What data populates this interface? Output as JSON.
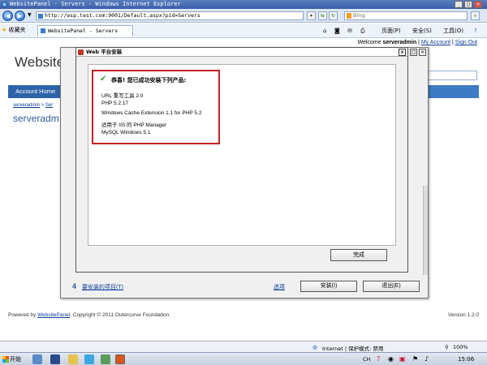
{
  "browser": {
    "window_title": "WebsitePanel - Servers - Windows Internet Explorer",
    "address": "http://wsp.test.com:9001/Default.aspx?pid=Servers",
    "search_placeholder": "Bing",
    "favorites_label": "收藏夹",
    "tab_title": "WebsitePanel - Servers",
    "commands": [
      "页面(P)",
      "安全(S)",
      "工具(O)"
    ],
    "status_zone": "Internet | 保护模式: 禁用",
    "zoom": "100%"
  },
  "page": {
    "welcome_prefix": "Welcome",
    "username": "serveradmin",
    "my_account": "My Account",
    "sign_out": "Sign Out",
    "logo": "Website",
    "menu_item": "Account Home",
    "breadcrumb": "serveradmin",
    "breadcrumb_tail": "Ser",
    "heading": "serveradm",
    "footer_prefix": "Powered by",
    "footer_link": "WebsitePanel",
    "footer_suffix": ". Copyright © 2011 Outercurve Foundation.",
    "version": "Version 1.2.0"
  },
  "outer_dialog": {
    "step_number": "4",
    "to_install_link": "要安装的项目(T)",
    "options_link": "选项",
    "install_button": "安装(I)",
    "exit_button": "退出(E)"
  },
  "inner_dialog": {
    "title": "Web 平台安装",
    "success_heading": "恭喜! 您已成功安装下列产品:",
    "products": [
      "URL 重写工具 2.0",
      "PHP 5.2.17",
      "Windows Cache Extension 1.1 for PHP 5.2",
      "适用于 IIS 的 PHP Manager",
      "MySQL Windows 5.1"
    ],
    "finish_button": "完成"
  },
  "taskbar": {
    "start_label": "开始",
    "lang": "CH",
    "clock": "15:06"
  },
  "colors": {
    "accent": "#3d7cc4",
    "highlight_border": "#c82020",
    "check": "#2e9e2e"
  }
}
